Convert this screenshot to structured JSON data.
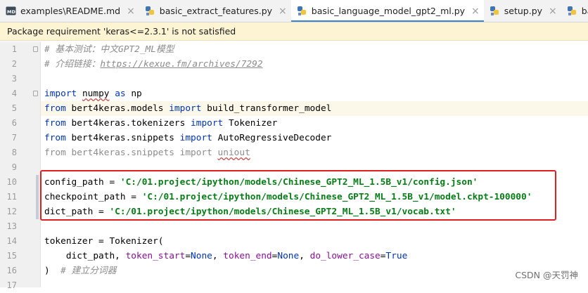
{
  "tabs": [
    {
      "label": "examples\\README.md",
      "icon": "markdown-file-icon",
      "active": false
    },
    {
      "label": "basic_extract_features.py",
      "icon": "python-file-icon",
      "active": false
    },
    {
      "label": "basic_language_model_gpt2_ml.py",
      "icon": "python-file-icon",
      "active": true
    },
    {
      "label": "setup.py",
      "icon": "python-file-icon",
      "active": false
    },
    {
      "label": "basic_languag",
      "icon": "python-file-icon",
      "active": false
    }
  ],
  "close_glyph": "×",
  "banner": {
    "text": "Package requirement 'keras<=2.3.1' is not satisfied"
  },
  "line_numbers": [
    "1",
    "2",
    "3",
    "4",
    "5",
    "6",
    "7",
    "8",
    "9",
    "10",
    "11",
    "12",
    "13",
    "14",
    "15",
    "16",
    "17"
  ],
  "code": {
    "l1": {
      "a": "# ",
      "b": "基本测试：中文GPT2_ML模型"
    },
    "l2": {
      "a": "# ",
      "b": "介绍链接：",
      "c": "https://kexue.fm/archives/7292"
    },
    "l4": {
      "a": "import",
      "b": " ",
      "c": "numpy",
      "d": " as ",
      "e": "np"
    },
    "l5": {
      "a": "from",
      "b": " bert4keras.models ",
      "c": "import",
      "d": " build_transformer_model"
    },
    "l6": {
      "a": "from",
      "b": " bert4keras.tokenizers ",
      "c": "import",
      "d": " Tokenizer"
    },
    "l7": {
      "a": "from",
      "b": " bert4keras.snippets ",
      "c": "import",
      "d": " AutoRegressiveDecoder"
    },
    "l8": {
      "a": "from bert4keras.snippets import ",
      "b": "uniout"
    },
    "l10": {
      "a": "config_path = ",
      "b": "'C:/01.project/ipython/models/Chinese_GPT2_ML_1.5B_v1/config.json'"
    },
    "l11": {
      "a": "checkpoint_path = ",
      "b": "'C:/01.project/ipython/models/Chinese_GPT2_ML_1.5B_v1/model.ckpt-100000'"
    },
    "l12": {
      "a": "dict_path = ",
      "b": "'C:/01.project/ipython/models/Chinese_GPT2_ML_1.5B_v1/vocab.txt'"
    },
    "l14": {
      "a": "tokenizer = Tokenizer("
    },
    "l15": {
      "a": "    dict_path, ",
      "b": "token_start",
      "c": "=",
      "d": "None",
      "e": ", ",
      "f": "token_end",
      "g": "=",
      "h": "None",
      "i": ", ",
      "j": "do_lower_case",
      "k": "=",
      "l": "True"
    },
    "l16": {
      "a": ")  ",
      "b": "# 建立分词器"
    }
  },
  "watermark": "CSDN @天罚神",
  "colors": {
    "keyword": "#0033b3",
    "string": "#067d17",
    "comment": "#8c8c8c",
    "param": "#871094",
    "highlight_box": "#e02020",
    "active_tab_underline": "#4083c9",
    "banner_bg": "#fdf4d3"
  }
}
